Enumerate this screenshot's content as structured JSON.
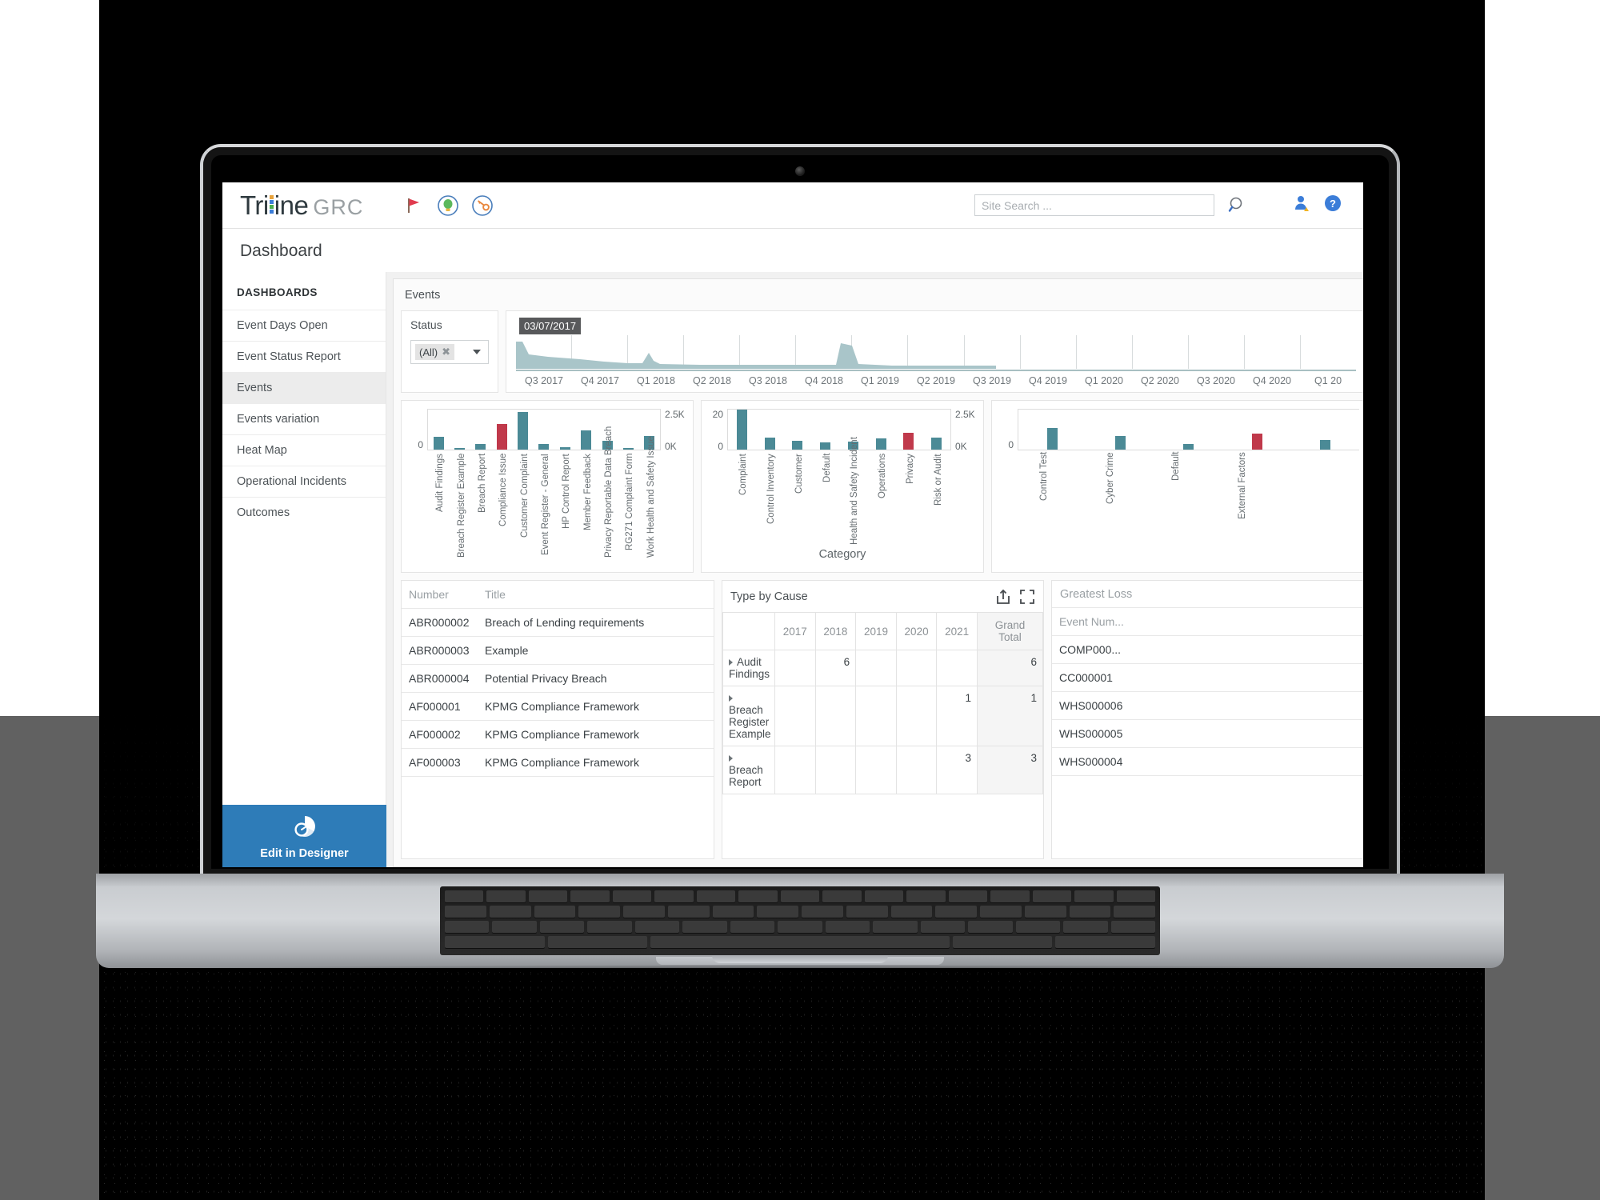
{
  "brand": {
    "name_dark": "Tri",
    "name_rest": "ine",
    "suffix": "GRC",
    "bar_colors": [
      "#e8a33d",
      "#3b7dd8",
      "#4caf50",
      "#3b7dd8"
    ]
  },
  "topbar": {
    "icons": [
      {
        "name": "flag-icon",
        "glyph": "flag"
      },
      {
        "name": "lightbulb-icon",
        "glyph": "bulb"
      },
      {
        "name": "key-icon",
        "glyph": "key"
      }
    ],
    "search": {
      "placeholder": "Site Search ...",
      "value": ""
    },
    "right_icons": [
      {
        "name": "user-alert-icon"
      },
      {
        "name": "help-icon",
        "label": "?"
      }
    ]
  },
  "page": {
    "title": "Dashboard"
  },
  "sidebar": {
    "heading": "DASHBOARDS",
    "items": [
      {
        "label": "Event Days Open",
        "active": false
      },
      {
        "label": "Event Status Report",
        "active": false
      },
      {
        "label": "Events",
        "active": true
      },
      {
        "label": "Events variation",
        "active": false
      },
      {
        "label": "Heat Map",
        "active": false
      },
      {
        "label": "Operational Incidents",
        "active": false
      },
      {
        "label": "Outcomes",
        "active": false
      }
    ],
    "designer_button": {
      "label": "Edit in Designer",
      "color": "#2e7cb8"
    }
  },
  "dashboard": {
    "title": "Events",
    "filter": {
      "label": "Status",
      "selected": "(All)",
      "clear_glyph": "✖"
    },
    "timeline": {
      "tooltip": "03/07/2017",
      "ticks": [
        "Q3 2017",
        "Q4 2017",
        "Q1 2018",
        "Q2 2018",
        "Q3 2018",
        "Q4 2018",
        "Q1 2019",
        "Q2 2019",
        "Q3 2019",
        "Q4 2019",
        "Q1 2020",
        "Q2 2020",
        "Q3 2020",
        "Q4 2020",
        "Q1 20"
      ],
      "area_color": "#a9c5c9"
    }
  },
  "chart_data": [
    {
      "type": "bar",
      "title": "",
      "xlabel": "",
      "ylabel": "",
      "ylim": [
        0,
        2500
      ],
      "axis_left_labels": [
        "0"
      ],
      "axis_right_labels": [
        "2.5K",
        "0K"
      ],
      "grid": false,
      "bar_color": "#4b8a96",
      "highlight_color": "#c0394b",
      "categories": [
        "Audit Findings",
        "Breach Register Example",
        "Breach Report",
        "Compliance Issue",
        "Customer Complaint",
        "Event Register - General",
        "HP Control Report",
        "Member Feedback",
        "Privacy Reportable Data Breach",
        "RG271 Complaint Form",
        "Work Health and Safety Issue"
      ],
      "values": [
        330,
        40,
        150,
        650,
        950,
        140,
        60,
        490,
        230,
        50,
        350
      ],
      "highlight_index": 3
    },
    {
      "type": "bar",
      "title": "",
      "xlabel": "Category",
      "ylabel": "",
      "ylim": [
        0,
        20
      ],
      "axis_left_labels": [
        "20",
        "0"
      ],
      "axis_right_labels": [
        "2.5K",
        "0K"
      ],
      "grid": false,
      "bar_color": "#4b8a96",
      "highlight_color": "#c0394b",
      "categories": [
        "Complaint",
        "Control Inventory",
        "Customer",
        "Default",
        "Health and Safety Incident",
        "Operations",
        "Privacy",
        "Risk or Audit"
      ],
      "values": [
        20,
        6,
        4.5,
        3.5,
        4,
        5.5,
        8.5,
        6
      ],
      "highlight_index": 6
    },
    {
      "type": "bar",
      "title": "",
      "xlabel": "",
      "ylabel": "",
      "ylim": [
        0,
        20
      ],
      "axis_left_labels": [
        "0"
      ],
      "axis_right_labels": [],
      "grid": false,
      "bar_color": "#4b8a96",
      "highlight_color": "#c0394b",
      "categories": [
        "Control Test",
        "Cyber Crime",
        "Default",
        "External Factors",
        ""
      ],
      "values": [
        11,
        7,
        3,
        8,
        5
      ],
      "highlight_index": 3
    }
  ],
  "events_table": {
    "columns": [
      "Number",
      "Title"
    ],
    "rows": [
      [
        "ABR000002",
        "Breach of Lending requirements"
      ],
      [
        "ABR000003",
        "Example"
      ],
      [
        "ABR000004",
        "Potential Privacy Breach"
      ],
      [
        "AF000001",
        "KPMG Compliance Framework"
      ],
      [
        "AF000002",
        "KPMG Compliance Framework"
      ],
      [
        "AF000003",
        "KPMG Compliance Framework"
      ]
    ]
  },
  "pivot": {
    "title": "Type by Cause",
    "icons": [
      {
        "name": "export-icon"
      },
      {
        "name": "expand-icon"
      }
    ],
    "columns": [
      "",
      "2017",
      "2018",
      "2019",
      "2020",
      "2021",
      "Grand Total"
    ],
    "rows": [
      {
        "label": "Audit Findings",
        "values": [
          "",
          "6",
          "",
          "",
          "",
          "6"
        ]
      },
      {
        "label": "Breach Register Example",
        "values": [
          "",
          "",
          "",
          "",
          "1",
          "1"
        ]
      },
      {
        "label": "Breach Report",
        "values": [
          "",
          "",
          "",
          "",
          "3",
          "3"
        ]
      }
    ]
  },
  "greatest_loss": {
    "title": "Greatest Loss",
    "columns": [
      "Event Num..."
    ],
    "rows": [
      "COMP000...",
      "CC000001",
      "WHS000006",
      "WHS000005",
      "WHS000004"
    ]
  }
}
